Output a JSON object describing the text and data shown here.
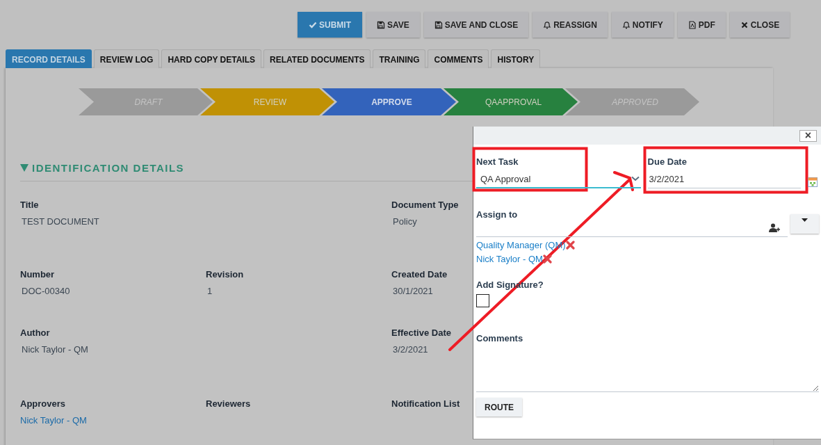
{
  "toolbar": [
    {
      "label": "SUBMIT",
      "primary": true
    },
    {
      "label": "SAVE",
      "primary": false
    },
    {
      "label": "SAVE AND CLOSE",
      "primary": false
    },
    {
      "label": "REASSIGN",
      "primary": false
    },
    {
      "label": "NOTIFY",
      "primary": false
    },
    {
      "label": "PDF",
      "primary": false
    },
    {
      "label": "CLOSE",
      "primary": false
    }
  ],
  "tabs": [
    {
      "label": "RECORD DETAILS",
      "selected": true
    },
    {
      "label": "REVIEW LOG",
      "selected": false
    },
    {
      "label": "HARD COPY DETAILS",
      "selected": false
    },
    {
      "label": "RELATED DOCUMENTS",
      "selected": false
    },
    {
      "label": "TRAINING",
      "selected": false
    },
    {
      "label": "COMMENTS",
      "selected": false
    },
    {
      "label": "HISTORY",
      "selected": false
    }
  ],
  "workflow": [
    {
      "label": "DRAFT",
      "kind": "inactive",
      "color": "#9a9a9a"
    },
    {
      "label": "REVIEW",
      "kind": "active",
      "color": "#c09105"
    },
    {
      "label": "APPROVE",
      "kind": "current",
      "color": "#3363bb"
    },
    {
      "label": "QAAPPROVAL",
      "kind": "active",
      "color": "#27813f"
    },
    {
      "label": "APPROVED",
      "kind": "inactive",
      "color": "#9a9a9a"
    }
  ],
  "section": {
    "title": "IDENTIFICATION DETAILS",
    "expanded": true
  },
  "field_rows": [
    [
      {
        "label": "Title",
        "value": "TEST DOCUMENT",
        "link": false
      },
      null,
      {
        "label": "Document Type",
        "value": "Policy",
        "link": false
      }
    ],
    [
      {
        "label": "Number",
        "value": "DOC-00340",
        "link": false
      },
      {
        "label": "Revision",
        "value": "1",
        "link": false
      },
      {
        "label": "Created Date",
        "value": "30/1/2021",
        "link": false
      }
    ],
    [
      {
        "label": "Author",
        "value": "Nick Taylor - QM",
        "link": false
      },
      null,
      {
        "label": "Effective Date",
        "value": "3/2/2021",
        "link": false
      }
    ],
    [
      {
        "label": "Approvers",
        "value": "Nick Taylor - QM",
        "link": true
      },
      {
        "label": "Reviewers"
      },
      {
        "label": "Notification List"
      }
    ]
  ],
  "dialog": {
    "close": "×",
    "next_task": {
      "label": "Next Task",
      "value": "QA Approval"
    },
    "due_date": {
      "label": "Due Date",
      "value": "3/2/2021"
    },
    "assign_to": {
      "label": "Assign to",
      "assignees": [
        "Quality Manager (QM)",
        "Nick Taylor - QM"
      ]
    },
    "signature": {
      "label": "Add Signature?",
      "checked": false
    },
    "comments": {
      "label": "Comments"
    },
    "route": "ROUTE"
  }
}
